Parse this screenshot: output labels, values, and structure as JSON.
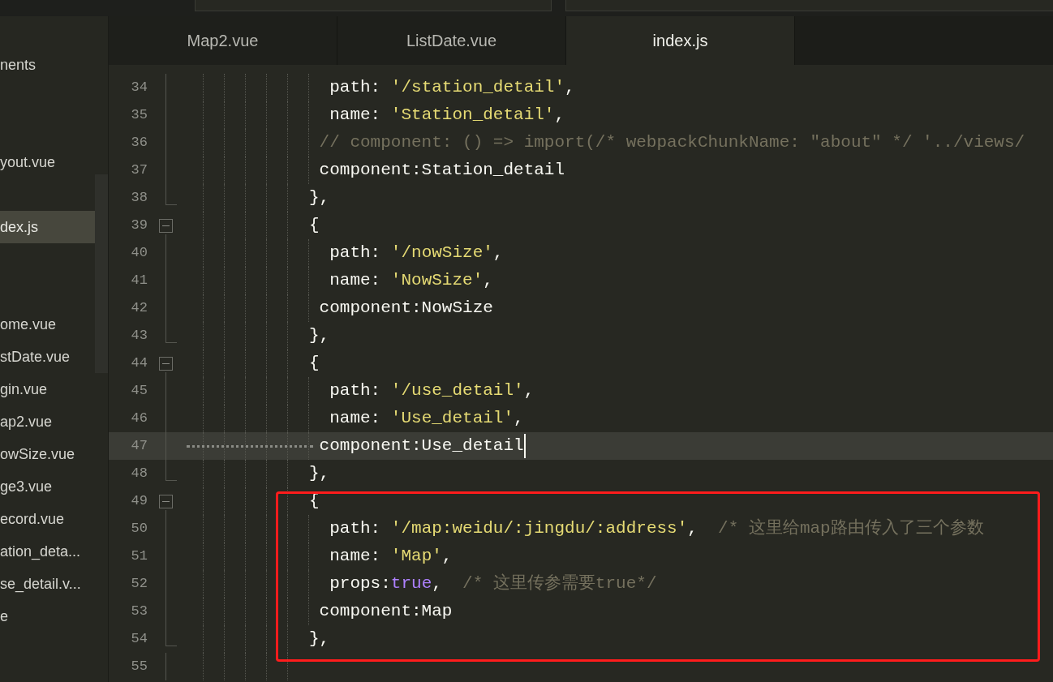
{
  "sidebar": {
    "items": [
      {
        "label": "nents",
        "selected": false
      },
      {
        "label": "yout.vue",
        "selected": false
      },
      {
        "label": "dex.js",
        "selected": true
      },
      {
        "label": "ome.vue",
        "selected": false
      },
      {
        "label": "stDate.vue",
        "selected": false
      },
      {
        "label": "gin.vue",
        "selected": false
      },
      {
        "label": "ap2.vue",
        "selected": false
      },
      {
        "label": "owSize.vue",
        "selected": false
      },
      {
        "label": "ge3.vue",
        "selected": false
      },
      {
        "label": "ecord.vue",
        "selected": false
      },
      {
        "label": "ation_deta...",
        "selected": false
      },
      {
        "label": "se_detail.v...",
        "selected": false
      },
      {
        "label": "e",
        "selected": false
      }
    ]
  },
  "tabs": [
    {
      "label": "Map2.vue",
      "selected": false
    },
    {
      "label": "ListDate.vue",
      "selected": false
    },
    {
      "label": "index.js",
      "selected": true
    }
  ],
  "editor": {
    "lines": [
      {
        "number": "34",
        "kind": "body",
        "current": false,
        "tokens": [
          {
            "kind": "plain",
            "text": "  path: "
          },
          {
            "kind": "string",
            "text": "'/station_detail'"
          },
          {
            "kind": "plain",
            "text": ","
          }
        ]
      },
      {
        "number": "35",
        "kind": "body",
        "current": false,
        "tokens": [
          {
            "kind": "plain",
            "text": "  name: "
          },
          {
            "kind": "string",
            "text": "'Station_detail'"
          },
          {
            "kind": "plain",
            "text": ","
          }
        ]
      },
      {
        "number": "36",
        "kind": "body",
        "current": false,
        "tokens": [
          {
            "kind": "comment",
            "text": " // component: () => import(/* webpackChunkName: \"about\" */ '../views/"
          }
        ]
      },
      {
        "number": "37",
        "kind": "body",
        "current": false,
        "tokens": [
          {
            "kind": "plain",
            "text": " component:Station_detail"
          }
        ]
      },
      {
        "number": "38",
        "kind": "close",
        "current": false,
        "tokens": [
          {
            "kind": "plain",
            "text": "},"
          }
        ]
      },
      {
        "number": "39",
        "kind": "open",
        "current": false,
        "tokens": [
          {
            "kind": "plain",
            "text": "{"
          }
        ]
      },
      {
        "number": "40",
        "kind": "body",
        "current": false,
        "tokens": [
          {
            "kind": "plain",
            "text": "  path: "
          },
          {
            "kind": "string",
            "text": "'/nowSize'"
          },
          {
            "kind": "plain",
            "text": ","
          }
        ]
      },
      {
        "number": "41",
        "kind": "body",
        "current": false,
        "tokens": [
          {
            "kind": "plain",
            "text": "  name: "
          },
          {
            "kind": "string",
            "text": "'NowSize'"
          },
          {
            "kind": "plain",
            "text": ","
          }
        ]
      },
      {
        "number": "42",
        "kind": "body",
        "current": false,
        "tokens": [
          {
            "kind": "plain",
            "text": " component:NowSize"
          }
        ]
      },
      {
        "number": "43",
        "kind": "close",
        "current": false,
        "tokens": [
          {
            "kind": "plain",
            "text": "},"
          }
        ]
      },
      {
        "number": "44",
        "kind": "open",
        "current": false,
        "tokens": [
          {
            "kind": "plain",
            "text": "{"
          }
        ]
      },
      {
        "number": "45",
        "kind": "body",
        "current": false,
        "tokens": [
          {
            "kind": "plain",
            "text": "  path: "
          },
          {
            "kind": "string",
            "text": "'/use_detail'"
          },
          {
            "kind": "plain",
            "text": ","
          }
        ]
      },
      {
        "number": "46",
        "kind": "body",
        "current": false,
        "tokens": [
          {
            "kind": "plain",
            "text": "  name: "
          },
          {
            "kind": "string",
            "text": "'Use_detail'"
          },
          {
            "kind": "plain",
            "text": ","
          }
        ]
      },
      {
        "number": "47",
        "kind": "body",
        "current": true,
        "tokens": [
          {
            "kind": "plain",
            "text": " component:Use_detail"
          }
        ]
      },
      {
        "number": "48",
        "kind": "close",
        "current": false,
        "tokens": [
          {
            "kind": "plain",
            "text": "},"
          }
        ]
      },
      {
        "number": "49",
        "kind": "open",
        "current": false,
        "tokens": [
          {
            "kind": "plain",
            "text": "{"
          }
        ]
      },
      {
        "number": "50",
        "kind": "body",
        "current": false,
        "tokens": [
          {
            "kind": "plain",
            "text": "  path: "
          },
          {
            "kind": "string",
            "text": "'/map:weidu/:jingdu/:address'"
          },
          {
            "kind": "plain",
            "text": ",  "
          },
          {
            "kind": "comment",
            "text": "/* 这里给map路由传入了三个参数"
          }
        ]
      },
      {
        "number": "51",
        "kind": "body",
        "current": false,
        "tokens": [
          {
            "kind": "plain",
            "text": "  name: "
          },
          {
            "kind": "string",
            "text": "'Map'"
          },
          {
            "kind": "plain",
            "text": ","
          }
        ]
      },
      {
        "number": "52",
        "kind": "body",
        "current": false,
        "tokens": [
          {
            "kind": "plain",
            "text": "  props:"
          },
          {
            "kind": "keyword",
            "text": "true"
          },
          {
            "kind": "plain",
            "text": ",  "
          },
          {
            "kind": "comment",
            "text": "/* 这里传参需要true*/"
          }
        ]
      },
      {
        "number": "53",
        "kind": "body",
        "current": false,
        "tokens": [
          {
            "kind": "plain",
            "text": " component:Map"
          }
        ]
      },
      {
        "number": "54",
        "kind": "close",
        "current": false,
        "tokens": [
          {
            "kind": "plain",
            "text": "},"
          }
        ]
      },
      {
        "number": "55",
        "kind": "body",
        "current": false
      }
    ]
  },
  "annotation": {
    "kind": "rectangle"
  }
}
